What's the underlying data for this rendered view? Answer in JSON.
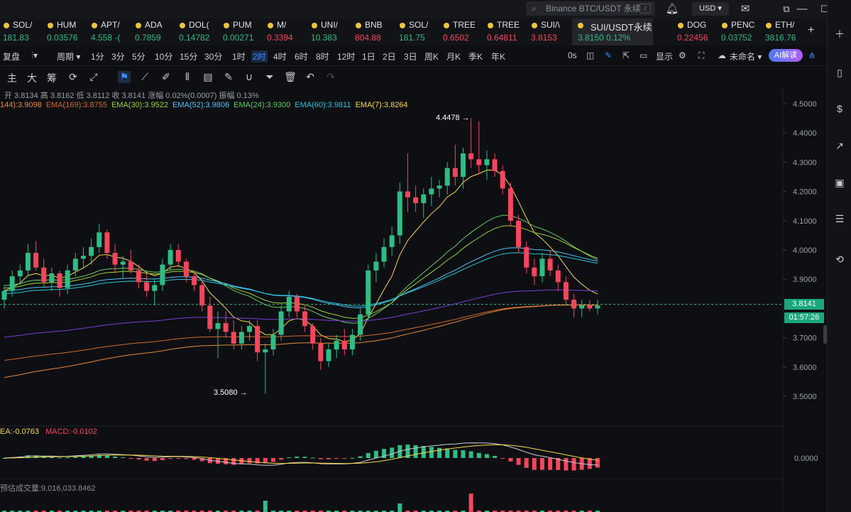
{
  "topbar": {
    "search_text": "Binance BTC/USDT 永续",
    "search_key": "/",
    "currency": "USD ▾"
  },
  "tickers": [
    {
      "sym": "SOL/",
      "px": "181.83",
      "dir": "up"
    },
    {
      "sym": "HUM",
      "px": "0.03576",
      "dir": "up"
    },
    {
      "sym": "APT/",
      "px": "4.558 -(",
      "dir": "up"
    },
    {
      "sym": "ADA",
      "px": "0.7859",
      "dir": "up"
    },
    {
      "sym": "DOL(",
      "px": "0.14782",
      "dir": "up"
    },
    {
      "sym": "PUM",
      "px": "0.00271",
      "dir": "up"
    },
    {
      "sym": "M/",
      "px": "0.3394",
      "dir": "dn"
    },
    {
      "sym": "UNI/",
      "px": "10.383",
      "dir": "up"
    },
    {
      "sym": "BNB",
      "px": "804.88",
      "dir": "dn"
    },
    {
      "sym": "SOL/",
      "px": "181.75",
      "dir": "up"
    },
    {
      "sym": "TREE",
      "px": "0.6502",
      "dir": "dn"
    },
    {
      "sym": "TREE",
      "px": "0.64811",
      "dir": "dn"
    },
    {
      "sym": "SUI/\\",
      "px": "3.8153",
      "dir": "dn"
    },
    {
      "sym": "SUI/USDT永续",
      "px": "3.8150  0.12%",
      "dir": "up",
      "active": true
    },
    {
      "sym": "DOG",
      "px": "0.22456",
      "dir": "dn"
    },
    {
      "sym": "PENC",
      "px": "0.03752",
      "dir": "up"
    },
    {
      "sym": "ETH/",
      "px": "3816.76",
      "dir": "up"
    }
  ],
  "toolbar1": {
    "items": [
      "复盘",
      "周期 ▾",
      "1分",
      "3分",
      "5分",
      "10分",
      "15分",
      "30分",
      "1时",
      "2时",
      "4时",
      "6时",
      "8时",
      "12时",
      "1日",
      "2日",
      "3日",
      "周K",
      "月K",
      "季K",
      "年K"
    ],
    "selected": "2时",
    "right": {
      "seconds": "0s",
      "display": "显示",
      "untitled": "未命名 ▾",
      "ai": "AI解读"
    }
  },
  "toolbar2": {
    "labels": [
      "主",
      "大",
      "筹"
    ]
  },
  "ohlc": "开 3.8134  高 3.8162  低 3.8112  收 3.8141  涨幅 0.02%(0.0007)  振幅 0.13%",
  "emas": [
    {
      "text": "144):3.9098",
      "color": "#e58a3c"
    },
    {
      "text": "EMA(169):3.8755",
      "color": "#d0692f"
    },
    {
      "text": "EMA(30):3.9522",
      "color": "#9bd33a"
    },
    {
      "text": "EMA(52):3.9806",
      "color": "#4fc3f7"
    },
    {
      "text": "EMA(24):3.9300",
      "color": "#64c96b"
    },
    {
      "text": "EMA(60):3.9811",
      "color": "#26c6da"
    },
    {
      "text": "EMA(7):3.8264",
      "color": "#f7d84a"
    }
  ],
  "price_axis": [
    "4.5000",
    "4.4000",
    "4.3000",
    "4.2000",
    "4.1000",
    "4.0000",
    "3.9000",
    "3.7000",
    "3.6000",
    "3.5000"
  ],
  "current_price": "3.8141",
  "countdown": "01:57:26",
  "high_label": "4.4478 →",
  "low_label": "3.5080 →",
  "macd": {
    "dea": "EA:-0.0763",
    "macd": "MACD:-0.0102",
    "axis": "0.0000"
  },
  "volume": {
    "label": "预估成交量:9,016,033.8462"
  },
  "colors": {
    "up": "#2ebd85",
    "down": "#f6465d",
    "accent": "#3c8bff"
  },
  "chart_data": {
    "type": "candlestick",
    "title": "SUI/USDT永续",
    "interval": "2时",
    "ylim": [
      3.45,
      4.52
    ],
    "candles": [
      [
        3.83,
        3.88,
        3.8,
        3.86
      ],
      [
        3.86,
        3.93,
        3.84,
        3.91
      ],
      [
        3.91,
        3.95,
        3.88,
        3.93
      ],
      [
        3.93,
        4.02,
        3.91,
        3.99
      ],
      [
        3.99,
        4.03,
        3.93,
        3.94
      ],
      [
        3.94,
        3.97,
        3.87,
        3.89
      ],
      [
        3.89,
        3.94,
        3.86,
        3.92
      ],
      [
        3.92,
        3.93,
        3.84,
        3.87
      ],
      [
        3.87,
        3.95,
        3.85,
        3.93
      ],
      [
        3.93,
        3.99,
        3.91,
        3.97
      ],
      [
        3.97,
        4.01,
        3.94,
        3.98
      ],
      [
        3.98,
        4.04,
        3.95,
        4.01
      ],
      [
        4.01,
        4.09,
        3.99,
        4.06
      ],
      [
        4.06,
        4.07,
        3.97,
        3.99
      ],
      [
        3.99,
        4.02,
        3.92,
        3.95
      ],
      [
        3.95,
        3.98,
        3.9,
        3.96
      ],
      [
        3.96,
        4.0,
        3.92,
        3.93
      ],
      [
        3.93,
        3.95,
        3.87,
        3.89
      ],
      [
        3.89,
        3.92,
        3.84,
        3.86
      ],
      [
        3.86,
        3.9,
        3.81,
        3.88
      ],
      [
        3.88,
        3.97,
        3.86,
        3.95
      ],
      [
        3.95,
        4.02,
        3.93,
        4.0
      ],
      [
        4.0,
        4.02,
        3.94,
        3.96
      ],
      [
        3.96,
        3.97,
        3.89,
        3.91
      ],
      [
        3.91,
        3.93,
        3.86,
        3.88
      ],
      [
        3.88,
        3.9,
        3.79,
        3.81
      ],
      [
        3.81,
        3.84,
        3.72,
        3.73
      ],
      [
        3.73,
        3.79,
        3.63,
        3.75
      ],
      [
        3.75,
        3.79,
        3.7,
        3.72
      ],
      [
        3.72,
        3.76,
        3.66,
        3.68
      ],
      [
        3.68,
        3.74,
        3.66,
        3.72
      ],
      [
        3.72,
        3.76,
        3.69,
        3.74
      ],
      [
        3.74,
        3.76,
        3.62,
        3.65
      ],
      [
        3.65,
        3.68,
        3.51,
        3.66
      ],
      [
        3.66,
        3.73,
        3.64,
        3.71
      ],
      [
        3.71,
        3.81,
        3.69,
        3.79
      ],
      [
        3.79,
        3.86,
        3.77,
        3.84
      ],
      [
        3.84,
        3.85,
        3.77,
        3.79
      ],
      [
        3.79,
        3.81,
        3.72,
        3.74
      ],
      [
        3.74,
        3.75,
        3.66,
        3.68
      ],
      [
        3.68,
        3.7,
        3.59,
        3.62
      ],
      [
        3.62,
        3.68,
        3.6,
        3.66
      ],
      [
        3.66,
        3.71,
        3.63,
        3.69
      ],
      [
        3.69,
        3.73,
        3.64,
        3.66
      ],
      [
        3.66,
        3.73,
        3.64,
        3.71
      ],
      [
        3.71,
        3.8,
        3.69,
        3.78
      ],
      [
        3.78,
        3.95,
        3.76,
        3.93
      ],
      [
        3.93,
        3.99,
        3.89,
        3.96
      ],
      [
        3.96,
        4.04,
        3.94,
        4.01
      ],
      [
        4.01,
        4.08,
        3.98,
        4.05
      ],
      [
        4.05,
        4.23,
        4.02,
        4.2
      ],
      [
        4.2,
        4.33,
        4.13,
        4.18
      ],
      [
        4.18,
        4.22,
        4.13,
        4.16
      ],
      [
        4.16,
        4.21,
        4.11,
        4.19
      ],
      [
        4.19,
        4.25,
        4.15,
        4.21
      ],
      [
        4.21,
        4.24,
        4.18,
        4.22
      ],
      [
        4.22,
        4.3,
        4.19,
        4.28
      ],
      [
        4.28,
        4.36,
        4.22,
        4.25
      ],
      [
        4.25,
        4.35,
        4.21,
        4.33
      ],
      [
        4.33,
        4.45,
        4.28,
        4.31
      ],
      [
        4.31,
        4.44,
        4.26,
        4.29
      ],
      [
        4.29,
        4.34,
        4.24,
        4.31
      ],
      [
        4.31,
        4.33,
        4.25,
        4.27
      ],
      [
        4.27,
        4.29,
        4.19,
        4.21
      ],
      [
        4.21,
        4.23,
        4.08,
        4.1
      ],
      [
        4.1,
        4.12,
        3.99,
        4.01
      ],
      [
        4.01,
        4.03,
        3.92,
        3.94
      ],
      [
        3.94,
        3.97,
        3.88,
        3.91
      ],
      [
        3.91,
        3.99,
        3.89,
        3.97
      ],
      [
        3.97,
        4.0,
        3.91,
        3.93
      ],
      [
        3.93,
        3.95,
        3.86,
        3.89
      ],
      [
        3.89,
        3.91,
        3.81,
        3.83
      ],
      [
        3.83,
        3.85,
        3.77,
        3.8
      ],
      [
        3.8,
        3.83,
        3.77,
        3.81
      ],
      [
        3.81,
        3.83,
        3.79,
        3.8
      ],
      [
        3.8,
        3.83,
        3.78,
        3.81
      ]
    ],
    "hi_lo": {
      "high": 4.4478,
      "low": 3.508
    },
    "current": 3.8141
  }
}
